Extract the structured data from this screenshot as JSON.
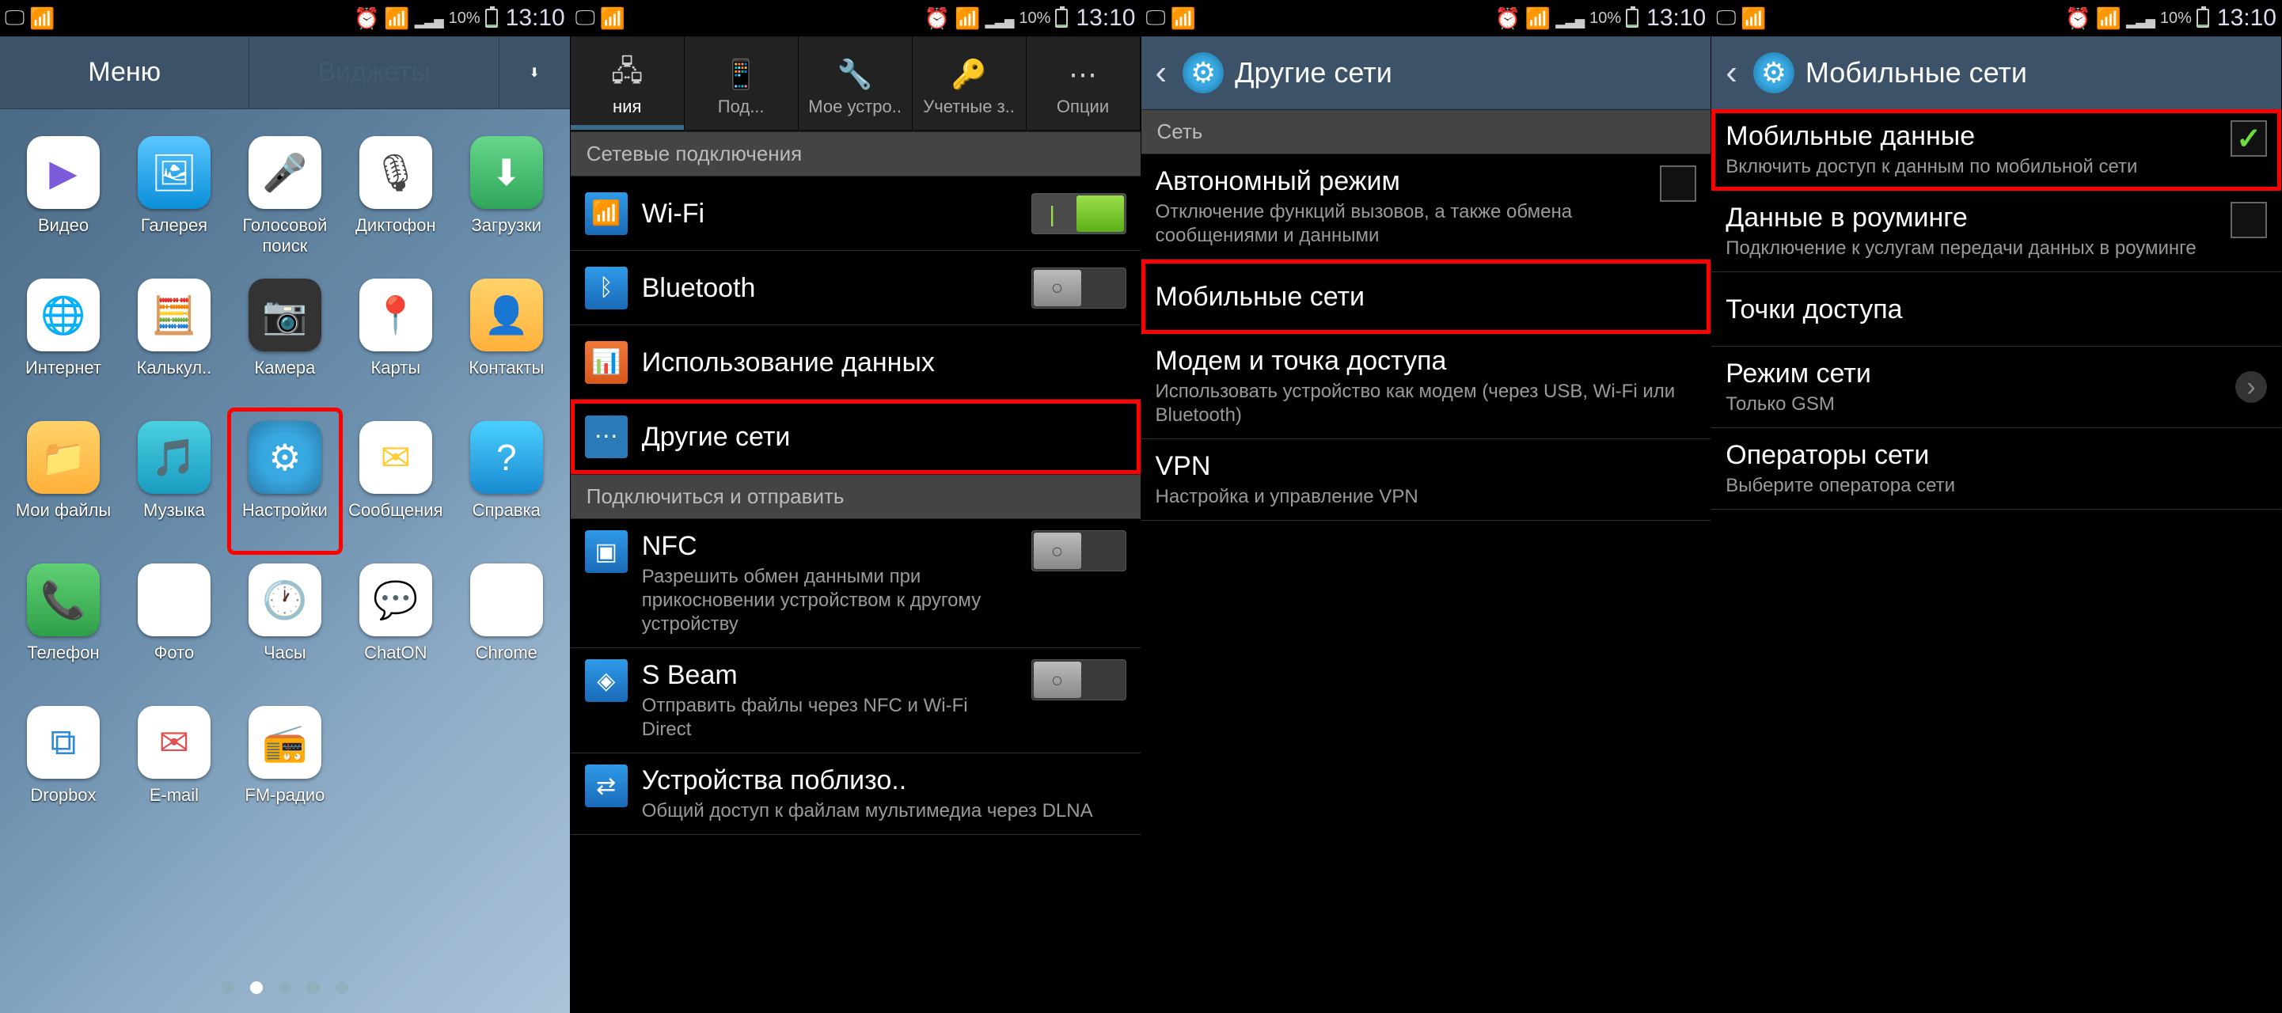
{
  "status": {
    "battery": "10%",
    "time": "13:10"
  },
  "launcher": {
    "tab_menu": "Меню",
    "tab_widgets": "Виджеты",
    "dots_count": 5,
    "dots_active": 1,
    "apps": [
      {
        "label": "Видео",
        "glyph": "▶",
        "cls": "ic-video"
      },
      {
        "label": "Галерея",
        "glyph": "🖼",
        "cls": "ic-gallery"
      },
      {
        "label": "Голосовой поиск",
        "glyph": "🎤",
        "cls": "ic-voice"
      },
      {
        "label": "Диктофон",
        "glyph": "🎙",
        "cls": "ic-recorder"
      },
      {
        "label": "Загрузки",
        "glyph": "⬇",
        "cls": "ic-downloads"
      },
      {
        "label": "Интернет",
        "glyph": "🌐",
        "cls": "ic-internet"
      },
      {
        "label": "Калькул..",
        "glyph": "🧮",
        "cls": "ic-calc"
      },
      {
        "label": "Камера",
        "glyph": "📷",
        "cls": "ic-camera"
      },
      {
        "label": "Карты",
        "glyph": "📍",
        "cls": "ic-maps"
      },
      {
        "label": "Контакты",
        "glyph": "👤",
        "cls": "ic-contacts"
      },
      {
        "label": "Мои файлы",
        "glyph": "📁",
        "cls": "ic-files"
      },
      {
        "label": "Музыка",
        "glyph": "🎵",
        "cls": "ic-music"
      },
      {
        "label": "Настройки",
        "glyph": "⚙",
        "cls": "ic-settings",
        "hi": true
      },
      {
        "label": "Сообщения",
        "glyph": "✉",
        "cls": "ic-messages"
      },
      {
        "label": "Справка",
        "glyph": "?",
        "cls": "ic-help"
      },
      {
        "label": "Телефон",
        "glyph": "📞",
        "cls": "ic-phone"
      },
      {
        "label": "Фото",
        "glyph": "✦",
        "cls": "ic-photos"
      },
      {
        "label": "Часы",
        "glyph": "🕐",
        "cls": "ic-clock"
      },
      {
        "label": "ChatON",
        "glyph": "💬",
        "cls": "ic-chaton"
      },
      {
        "label": "Chrome",
        "glyph": "◉",
        "cls": "ic-chrome"
      },
      {
        "label": "Dropbox",
        "glyph": "⧉",
        "cls": "ic-dropbox"
      },
      {
        "label": "E-mail",
        "glyph": "✉",
        "cls": "ic-email"
      },
      {
        "label": "FM-радио",
        "glyph": "📻",
        "cls": "ic-radio"
      }
    ]
  },
  "settings": {
    "tabs": [
      {
        "label": "ния",
        "glyph": "🖧"
      },
      {
        "label": "Под...",
        "glyph": "📱"
      },
      {
        "label": "Мое устро..",
        "glyph": "🔧"
      },
      {
        "label": "Учетные з..",
        "glyph": "🔑"
      },
      {
        "label": "Опции",
        "glyph": "⋯"
      }
    ],
    "sec1": "Сетевые подключения",
    "wifi": "Wi-Fi",
    "bt": "Bluetooth",
    "du": "Использование данных",
    "more": {
      "title": "Другие сети",
      "hi": true
    },
    "sec2": "Подключиться и отправить",
    "nfc": {
      "title": "NFC",
      "sub": "Разрешить обмен данными при прикосновении устройством к другому устройству"
    },
    "sbeam": {
      "title": "S Beam",
      "sub": "Отправить файлы через NFC и Wi-Fi Direct"
    },
    "nb": {
      "title": "Устройства поблизо..",
      "sub": "Общий доступ к файлам мультимедиа через DLNA"
    }
  },
  "other_networks": {
    "title": "Другие сети",
    "sec": "Сеть",
    "airplane": {
      "title": "Автономный режим",
      "sub": "Отключение функций вызовов, а также обмена сообщениями и данными"
    },
    "mobile": {
      "title": "Мобильные сети",
      "hi": true
    },
    "tether": {
      "title": "Модем и точка доступа",
      "sub": "Использовать устройство как модем (через USB, Wi-Fi или Bluetooth)"
    },
    "vpn": {
      "title": "VPN",
      "sub": "Настройка и управление VPN"
    }
  },
  "mobile_networks": {
    "title": "Мобильные сети",
    "mdata": {
      "title": "Мобильные данные",
      "sub": "Включить доступ к данным по мобильной сети",
      "hi": true,
      "checked": true
    },
    "roaming": {
      "title": "Данные в роуминге",
      "sub": "Подключение к услугам передачи данных в роуминге",
      "checked": false
    },
    "apn": {
      "title": "Точки доступа"
    },
    "mode": {
      "title": "Режим сети",
      "sub": "Только GSM"
    },
    "oper": {
      "title": "Операторы сети",
      "sub": "Выберите оператора сети"
    }
  }
}
